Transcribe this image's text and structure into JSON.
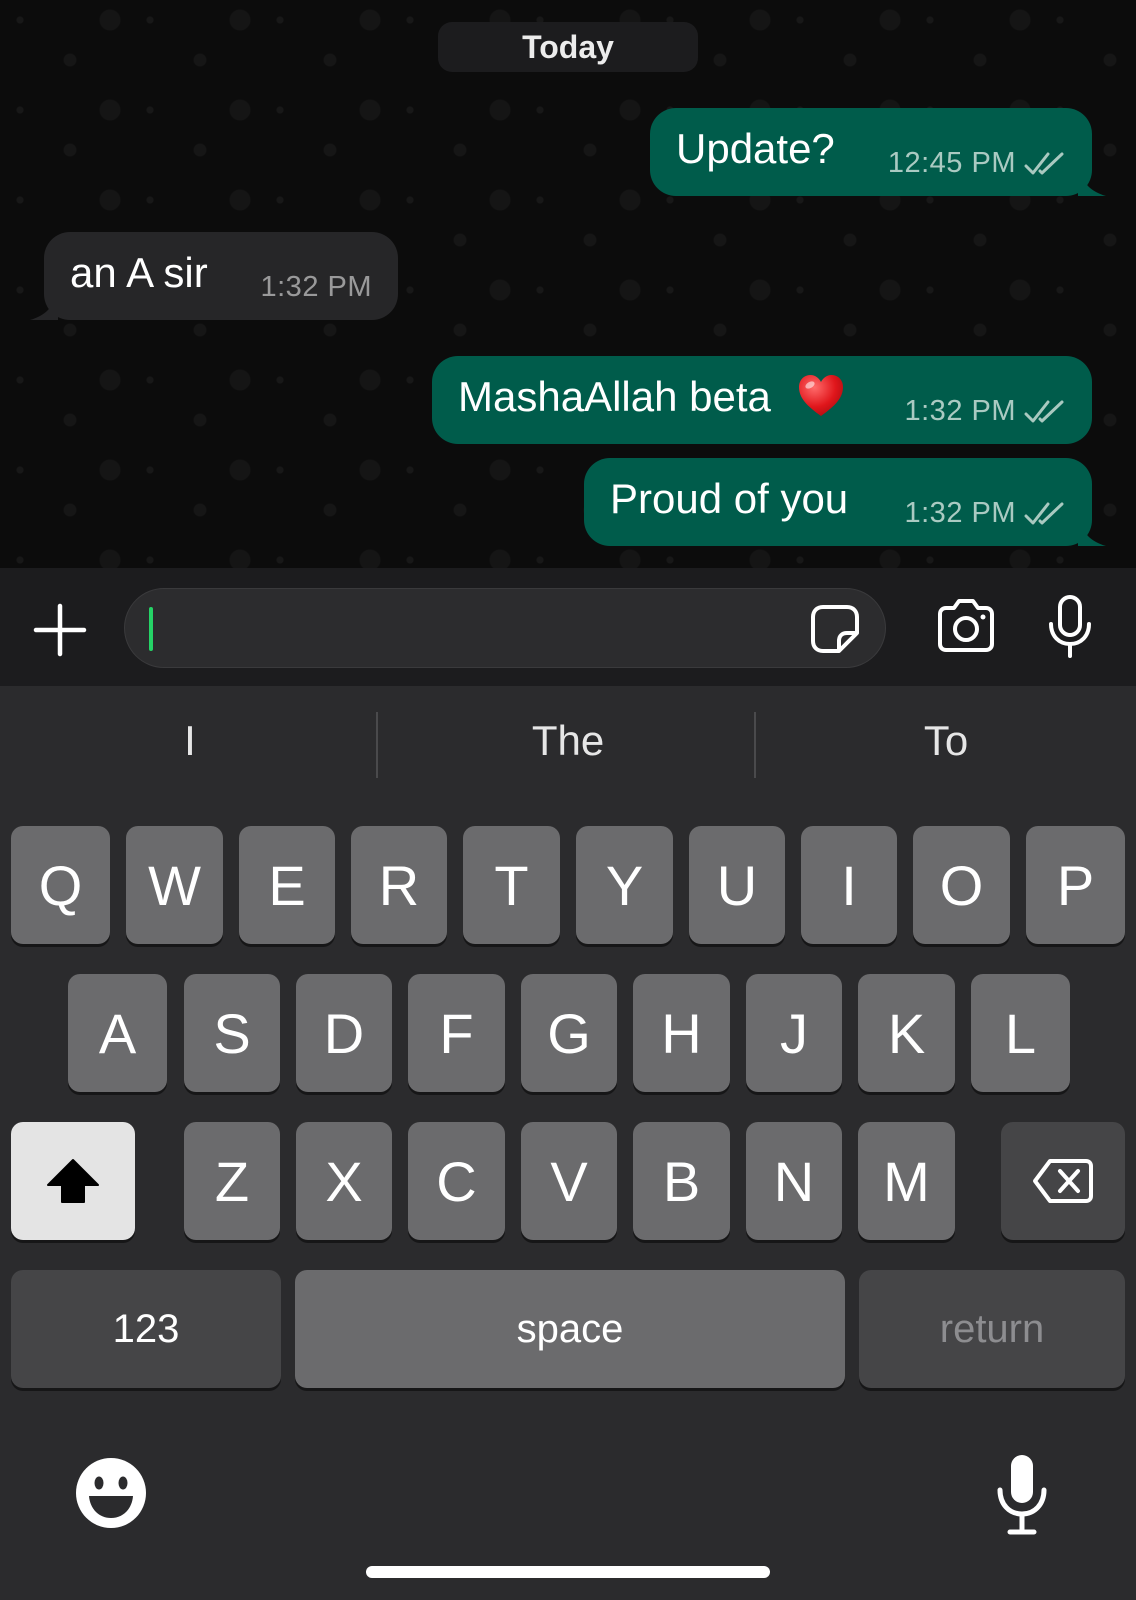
{
  "chat": {
    "date_label": "Today",
    "messages": [
      {
        "direction": "outgoing",
        "text": "Update?",
        "time": "12:45 PM",
        "status": "read"
      },
      {
        "direction": "incoming",
        "text": "an A sir",
        "time": "1:32 PM"
      },
      {
        "direction": "outgoing",
        "text": "MashaAllah beta",
        "emoji": "red-heart",
        "time": "1:32 PM",
        "status": "read"
      },
      {
        "direction": "outgoing",
        "text": "Proud of you",
        "time": "1:32 PM",
        "status": "read"
      }
    ]
  },
  "composer": {
    "placeholder": "",
    "value": "",
    "icons": [
      "plus-icon",
      "sticker-icon",
      "camera-icon",
      "microphone-icon"
    ]
  },
  "keyboard": {
    "suggestions": [
      "I",
      "The",
      "To"
    ],
    "rows": [
      [
        "Q",
        "W",
        "E",
        "R",
        "T",
        "Y",
        "U",
        "I",
        "O",
        "P"
      ],
      [
        "A",
        "S",
        "D",
        "F",
        "G",
        "H",
        "J",
        "K",
        "L"
      ],
      [
        "Z",
        "X",
        "C",
        "V",
        "B",
        "N",
        "M"
      ]
    ],
    "numbers_label": "123",
    "space_label": "space",
    "return_label": "return",
    "icons": [
      "shift-icon",
      "backspace-icon",
      "emoji-icon",
      "dictation-icon"
    ]
  },
  "colors": {
    "outgoing_bubble": "#005c4b",
    "incoming_bubble": "#262628",
    "caret": "#25d366",
    "keyboard_bg": "#2b2b2d",
    "key": "#6b6b6d"
  }
}
